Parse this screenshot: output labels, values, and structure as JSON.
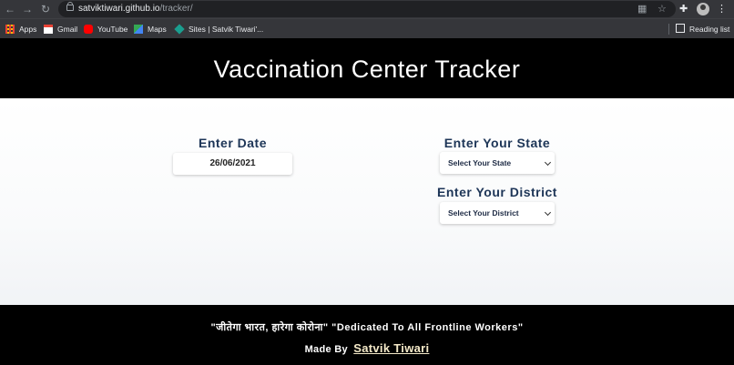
{
  "browser": {
    "url_host": "satviktiwari.github.io",
    "url_path": "/tracker/",
    "bookmarks": [
      "Apps",
      "Gmail",
      "YouTube",
      "Maps",
      "Sites | Satvik Tiwari'..."
    ],
    "reading_list": "Reading list",
    "icons": [
      "back-icon",
      "forward-icon",
      "reload-icon",
      "lock-icon",
      "qr-code-icon",
      "star-icon",
      "extensions-icon",
      "profile-avatar",
      "menu-icon"
    ]
  },
  "header": {
    "title": "Vaccination Center Tracker"
  },
  "form": {
    "date_label": "Enter Date",
    "date_value": "26/06/2021",
    "state_label": "Enter Your State",
    "state_selected": "Select Your State",
    "district_label": "Enter Your District",
    "district_selected": "Select Your District"
  },
  "footer": {
    "quote": "\"जीतेगा भारत, हारेगा कोरोना\" \"Dedicated To All Frontline Workers\"",
    "made_by_label": "Made By",
    "author": "Satvik Tiwari"
  },
  "colors": {
    "label": "#1d3557",
    "header_bg": "#000000",
    "author_link": "#f4e9c8"
  }
}
